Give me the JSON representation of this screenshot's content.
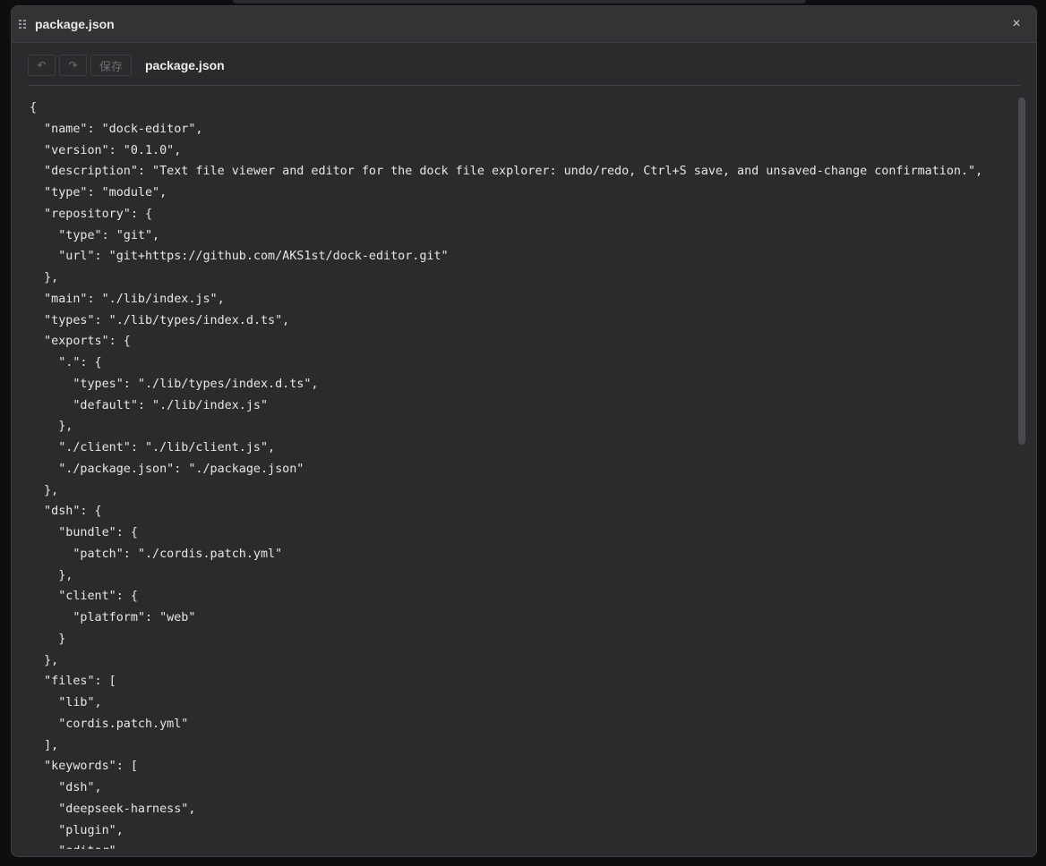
{
  "window": {
    "title": "package.json",
    "close_glyph": "×",
    "drag_icon": "grip-icon",
    "close_icon": "close-icon"
  },
  "toolbar": {
    "undo_glyph": "↶",
    "redo_glyph": "↷",
    "save_label": "保存",
    "file_name": "package.json"
  },
  "editor": {
    "lines": [
      "{",
      "  \"name\": \"dock-editor\",",
      "  \"version\": \"0.1.0\",",
      "  \"description\": \"Text file viewer and editor for the dock file explorer: undo/redo, Ctrl+S save, and unsaved-change confirmation.\",",
      "  \"type\": \"module\",",
      "  \"repository\": {",
      "    \"type\": \"git\",",
      "    \"url\": \"git+https://github.com/AKS1st/dock-editor.git\"",
      "  },",
      "  \"main\": \"./lib/index.js\",",
      "  \"types\": \"./lib/types/index.d.ts\",",
      "  \"exports\": {",
      "    \".\": {",
      "      \"types\": \"./lib/types/index.d.ts\",",
      "      \"default\": \"./lib/index.js\"",
      "    },",
      "    \"./client\": \"./lib/client.js\",",
      "    \"./package.json\": \"./package.json\"",
      "  },",
      "  \"dsh\": {",
      "    \"bundle\": {",
      "      \"patch\": \"./cordis.patch.yml\"",
      "    },",
      "    \"client\": {",
      "      \"platform\": \"web\"",
      "    }",
      "  },",
      "  \"files\": [",
      "    \"lib\",",
      "    \"cordis.patch.yml\"",
      "  ],",
      "  \"keywords\": [",
      "    \"dsh\",",
      "    \"deepseek-harness\",",
      "    \"plugin\",",
      "    \"editor\","
    ]
  },
  "colors": {
    "window_bg": "#2b2b2d",
    "titlebar_bg": "#333336",
    "text": "#e6e6e8"
  }
}
